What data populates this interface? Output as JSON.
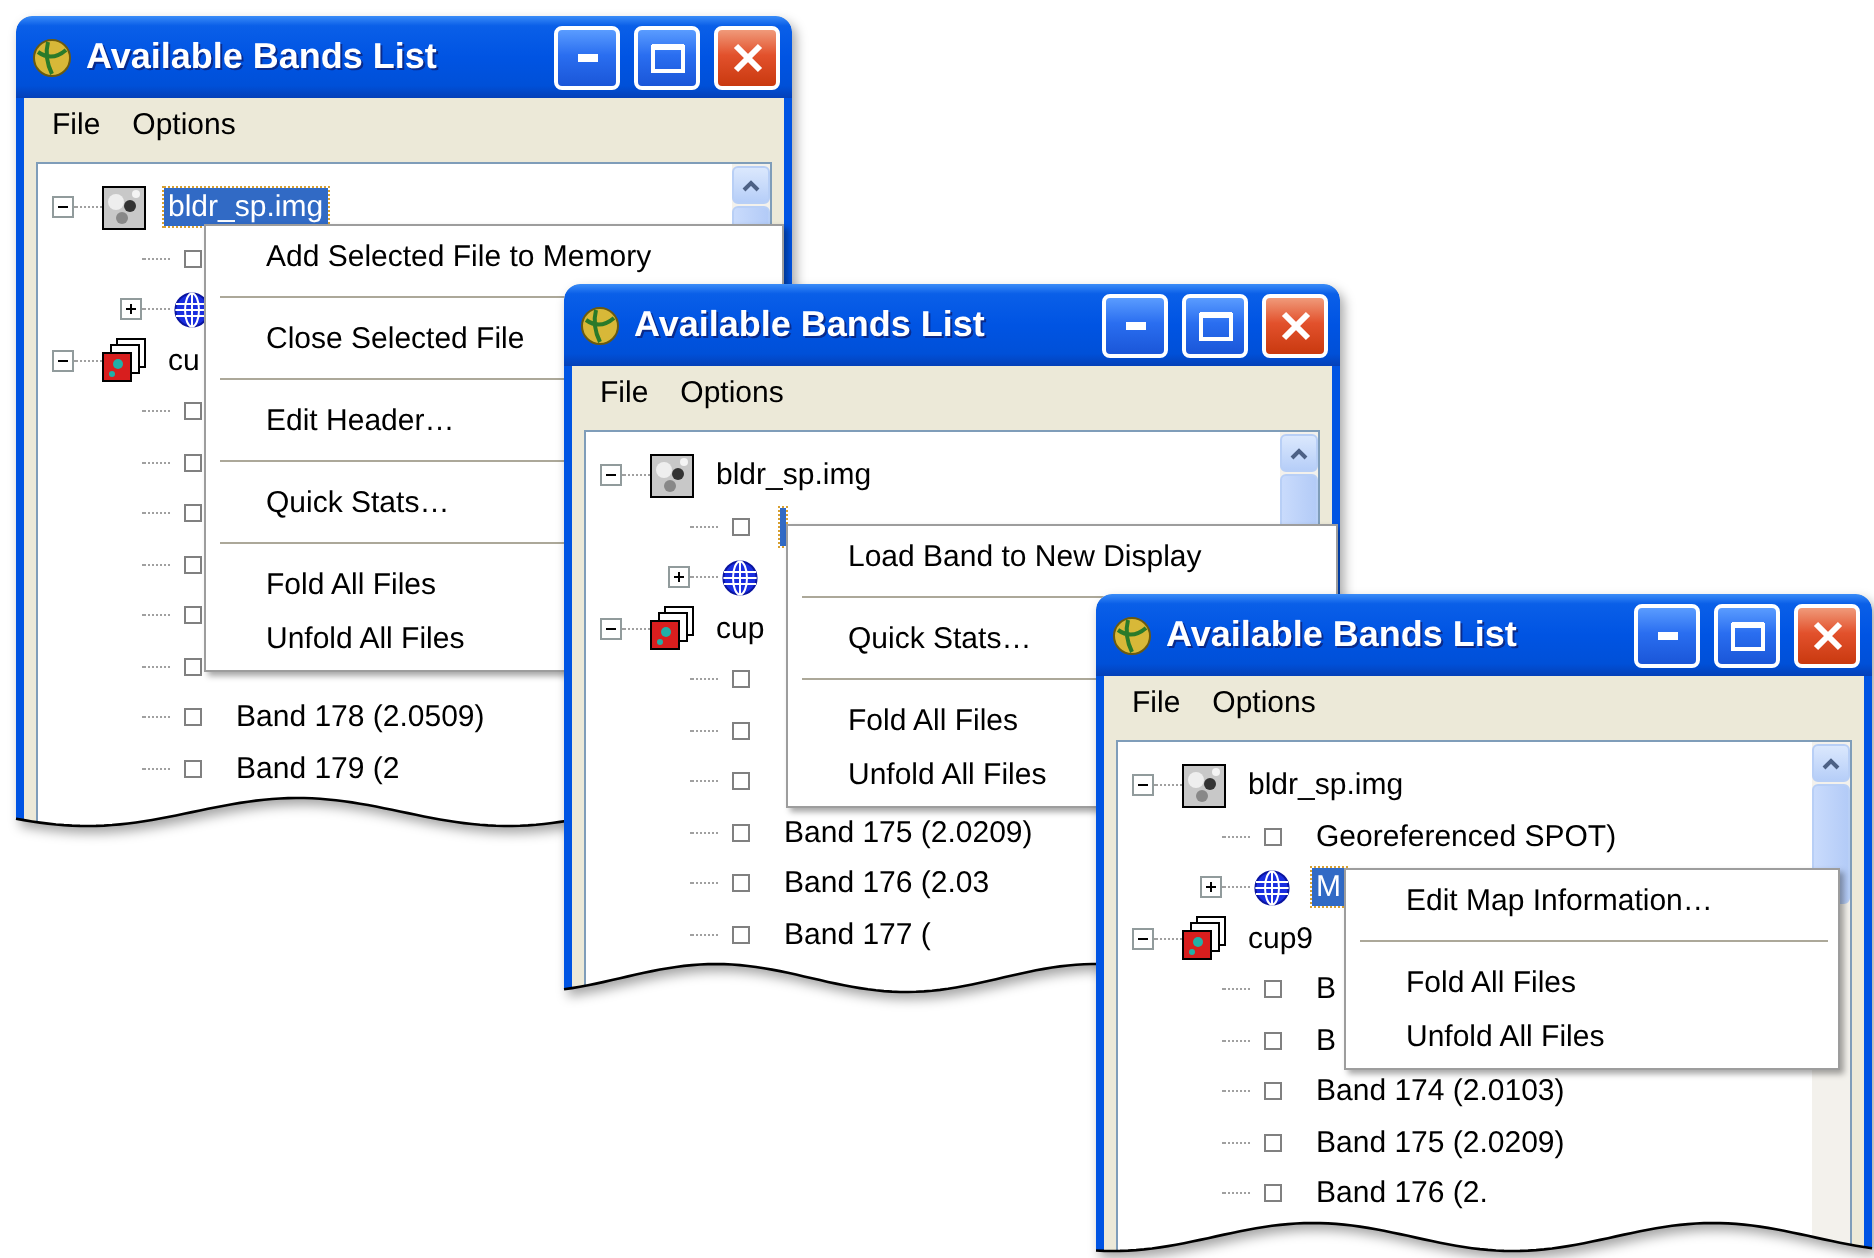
{
  "windows": [
    {
      "title": "Available Bands List",
      "menu": [
        "File",
        "Options"
      ],
      "tree": [
        {
          "kind": "image",
          "label": "bldr_sp.img",
          "selected": true,
          "expanded": true,
          "children": [
            {
              "kind": "band",
              "selected": false
            },
            {
              "kind": "map",
              "selected": false,
              "expanded": false
            }
          ]
        },
        {
          "kind": "stack",
          "label": "cu",
          "selected": false,
          "expanded": true,
          "children": [
            {
              "kind": "band",
              "selected": false
            },
            {
              "kind": "band",
              "selected": false
            },
            {
              "kind": "band",
              "selected": false
            },
            {
              "kind": "band",
              "selected": false
            },
            {
              "kind": "band",
              "selected": false
            },
            {
              "kind": "band",
              "selected": false
            },
            {
              "kind": "band",
              "label": "Band 178 (2.0509)",
              "selected": false
            },
            {
              "kind": "band",
              "label": "Band 179 (2",
              "selected": false
            }
          ]
        }
      ],
      "context_menu": {
        "groups": [
          [
            "Add Selected File to Memory"
          ],
          [
            "Close Selected File"
          ],
          [
            "Edit Header…"
          ],
          [
            "Quick Stats…"
          ],
          [
            "Fold All Files",
            "Unfold All Files"
          ]
        ]
      }
    },
    {
      "title": "Available Bands List",
      "menu": [
        "File",
        "Options"
      ],
      "tree": [
        {
          "kind": "image",
          "label": "bldr_sp.img",
          "selected": false,
          "expanded": true,
          "children": [
            {
              "kind": "band",
              "selected": true
            },
            {
              "kind": "map",
              "selected": false,
              "expanded": false
            }
          ]
        },
        {
          "kind": "stack",
          "label": "cup",
          "selected": false,
          "expanded": true,
          "children": [
            {
              "kind": "band",
              "selected": false
            },
            {
              "kind": "band",
              "selected": false
            },
            {
              "kind": "band",
              "selected": false
            },
            {
              "kind": "band",
              "label": "Band 175 (2.0209)",
              "selected": false
            },
            {
              "kind": "band",
              "label": "Band 176 (2.03",
              "selected": false
            },
            {
              "kind": "band",
              "label": "Band 177 (",
              "selected": false
            }
          ]
        }
      ],
      "context_menu": {
        "groups": [
          [
            "Load Band to New Display"
          ],
          [
            "Quick Stats…"
          ],
          [
            "Fold All Files",
            "Unfold All Files"
          ]
        ]
      }
    },
    {
      "title": "Available Bands List",
      "menu": [
        "File",
        "Options"
      ],
      "tree": [
        {
          "kind": "image",
          "label": "bldr_sp.img",
          "selected": false,
          "expanded": true,
          "children": [
            {
              "kind": "band",
              "label": "Georeferenced SPOT)",
              "selected": false
            },
            {
              "kind": "map",
              "label": "M",
              "selected": true,
              "expanded": false
            }
          ]
        },
        {
          "kind": "stack",
          "label": "cup9",
          "selected": false,
          "expanded": true,
          "children": [
            {
              "kind": "band",
              "label": "B",
              "selected": false
            },
            {
              "kind": "band",
              "label": "B",
              "selected": false
            },
            {
              "kind": "band",
              "label": "Band 174 (2.0103)",
              "selected": false
            },
            {
              "kind": "band",
              "label": "Band 175 (2.0209)",
              "selected": false
            },
            {
              "kind": "band",
              "label": "Band 176 (2.",
              "selected": false
            }
          ]
        }
      ],
      "context_menu": {
        "groups": [
          [
            "Edit Map Information…"
          ],
          [
            "Fold All Files",
            "Unfold All Files"
          ]
        ]
      }
    }
  ]
}
